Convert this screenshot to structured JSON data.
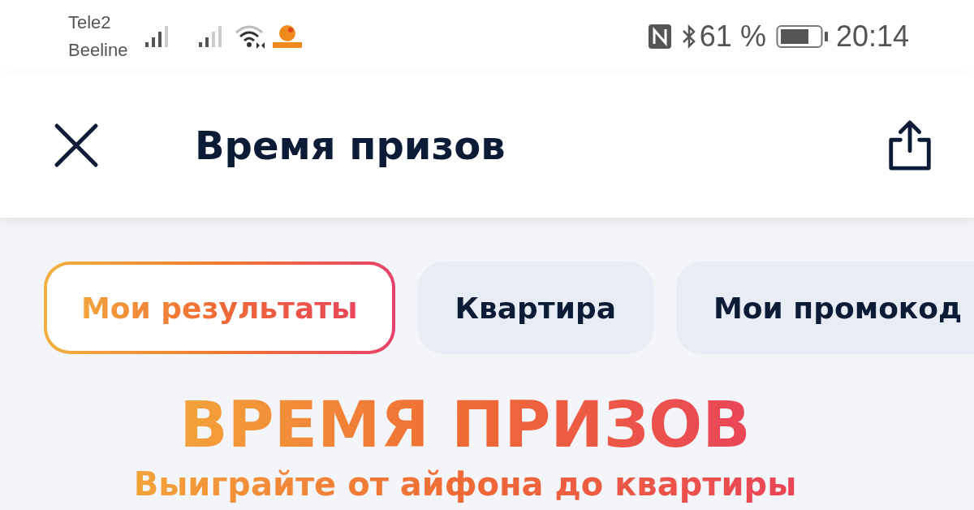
{
  "status_bar": {
    "carriers": [
      "Tele2",
      "Beeline"
    ],
    "battery_percent": "61 %",
    "time": "20:14"
  },
  "header": {
    "title": "Время призов"
  },
  "tabs": [
    {
      "label": "Мои результаты",
      "selected": true
    },
    {
      "label": "Квартира",
      "selected": false
    },
    {
      "label": "Мои промокод",
      "selected": false
    }
  ],
  "promo": {
    "title": "ВРЕМЯ ПРИЗОВ",
    "subtitle": "Выиграйте от айфона до квартиры"
  }
}
